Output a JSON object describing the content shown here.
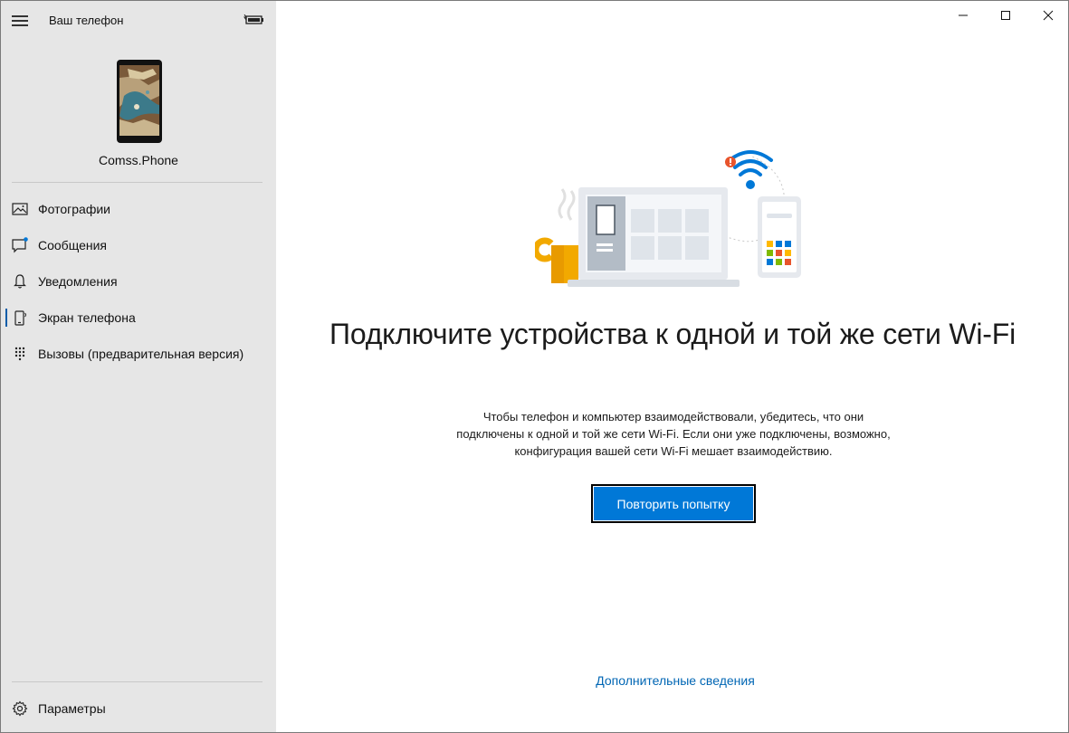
{
  "app": {
    "title": "Ваш телефон",
    "device_name": "Comss.Phone"
  },
  "sidebar": {
    "items": [
      {
        "label": "Фотографии",
        "icon": "photos-icon",
        "active": false
      },
      {
        "label": "Сообщения",
        "icon": "messages-icon",
        "active": false
      },
      {
        "label": "Уведомления",
        "icon": "bell-icon",
        "active": false
      },
      {
        "label": "Экран телефона",
        "icon": "phone-screen-icon",
        "active": true
      },
      {
        "label": "Вызовы (предварительная версия)",
        "icon": "dialpad-icon",
        "active": false
      }
    ],
    "settings_label": "Параметры"
  },
  "main": {
    "headline": "Подключите устройства к одной и той же сети Wi-Fi",
    "description": "Чтобы телефон и компьютер взаимодействовали, убедитесь, что они подключены к одной и той же сети Wi-Fi. Если они уже подключены, возможно, конфигурация вашей сети Wi-Fi мешает взаимодействию.",
    "retry_button": "Повторить попытку",
    "more_info_link": "Дополнительные сведения"
  },
  "colors": {
    "accent": "#0078d7",
    "link": "#0066b4",
    "sidebar_bg": "#e6e6e6",
    "warning": "#e8542c"
  }
}
